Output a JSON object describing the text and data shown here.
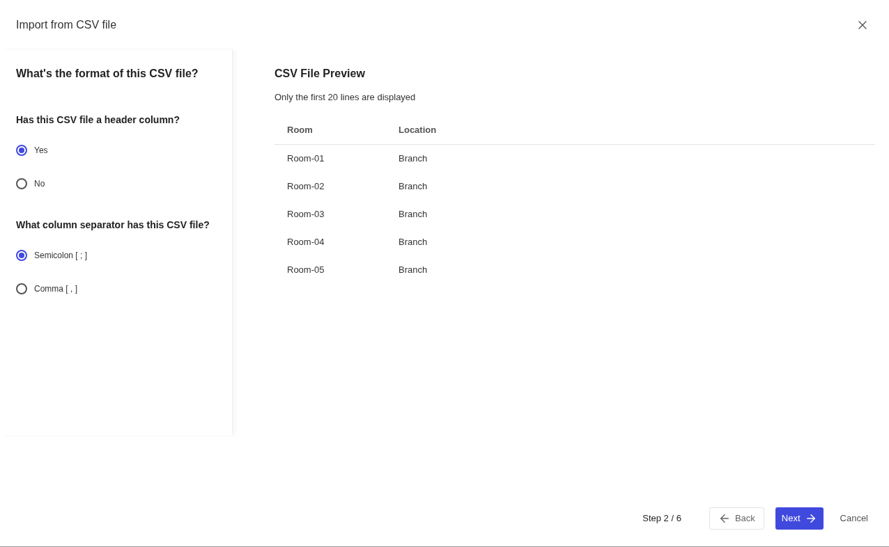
{
  "dialog": {
    "title": "Import from CSV file"
  },
  "format_panel": {
    "title": "What's the format of this CSV file?",
    "questions": [
      {
        "label": "Has this CSV file a header column?",
        "options": [
          {
            "label": "Yes",
            "selected": true
          },
          {
            "label": "No",
            "selected": false
          }
        ]
      },
      {
        "label": "What column separator has this CSV file?",
        "options": [
          {
            "label": "Semicolon [ ; ]",
            "selected": true
          },
          {
            "label": "Comma [ , ]",
            "selected": false
          }
        ]
      }
    ]
  },
  "preview": {
    "title": "CSV File Preview",
    "subtitle": "Only the first 20 lines are displayed",
    "table": {
      "columns": [
        "Room",
        "Location"
      ],
      "rows": [
        [
          "Room-01",
          "Branch"
        ],
        [
          "Room-02",
          "Branch"
        ],
        [
          "Room-03",
          "Branch"
        ],
        [
          "Room-04",
          "Branch"
        ],
        [
          "Room-05",
          "Branch"
        ]
      ]
    }
  },
  "footer": {
    "step": "Step 2 / 6",
    "back": "Back",
    "next": "Next",
    "cancel": "Cancel"
  }
}
